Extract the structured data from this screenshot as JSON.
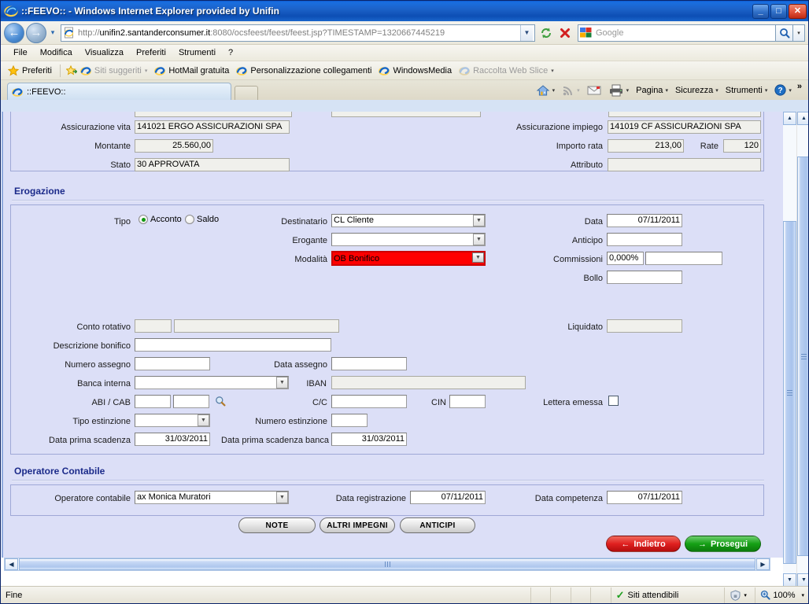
{
  "window": {
    "title": "::FEEVO:: - Windows Internet Explorer provided by Unifin",
    "minimize_label": "_",
    "maximize_label": "□",
    "close_label": "✕"
  },
  "browser": {
    "back_label": "←",
    "forward_label": "→",
    "history_label": "▾",
    "url_prefix": "http://",
    "url_host": "unifin2.santanderconsumer.it",
    "url_rest": ":8080/ocsfeest/feest/feest.jsp?TIMESTAMP=1320667445219",
    "url_full": "http://unifin2.santanderconsumer.it:8080/ocsfeest/feest/feest.jsp?TIMESTAMP=1320667445219",
    "refresh_label": "↻",
    "stop_label": "✕",
    "search_placeholder": "Google",
    "search_value": "",
    "search_go_label": "⌕",
    "search_drop_label": "▾"
  },
  "menu": {
    "items": [
      {
        "label": "File"
      },
      {
        "label": "Modifica"
      },
      {
        "label": "Visualizza"
      },
      {
        "label": "Preferiti"
      },
      {
        "label": "Strumenti"
      },
      {
        "label": "?"
      }
    ]
  },
  "favorites": {
    "button_label": "Preferiti",
    "items": [
      {
        "label": "Siti suggeriti",
        "dim": true,
        "caret": "▾"
      },
      {
        "label": "HotMail gratuita",
        "dim": false,
        "caret": ""
      },
      {
        "label": "Personalizzazione collegamenti",
        "dim": false,
        "caret": ""
      },
      {
        "label": "WindowsMedia",
        "dim": false,
        "caret": ""
      },
      {
        "label": "Raccolta Web Slice",
        "dim": true,
        "caret": "▾"
      }
    ]
  },
  "tabs": {
    "active": {
      "label": "::FEEVO::"
    },
    "new_tab_label": ""
  },
  "command_bar": {
    "home_caret": "▾",
    "feeds_caret": "▾",
    "mail_caret": "",
    "print_caret": "▾",
    "items": [
      {
        "label": "Pagina",
        "caret": "▾"
      },
      {
        "label": "Sicurezza",
        "caret": "▾"
      },
      {
        "label": "Strumenti",
        "caret": "▾"
      },
      {
        "label": "",
        "caret": "▾"
      }
    ],
    "overflow_label": "»"
  },
  "form": {
    "top_rows": [
      {
        "label": "Assicurazione vita",
        "value": "141021 ERGO ASSICURAZIONI SPA"
      },
      {
        "label": "Montante",
        "value": "25.560,00"
      },
      {
        "label": "Stato",
        "value": "30 APPROVATA"
      }
    ],
    "top_rows_right": [
      {
        "label": "Assicurazione impiego",
        "value": "141019 CF ASSICURAZIONI SPA"
      },
      {
        "label": "Importo rata",
        "value": "213,00"
      },
      {
        "label": "Attributo",
        "value": ""
      }
    ],
    "rate": {
      "label": "Rate",
      "value": "120"
    }
  },
  "erogazione": {
    "section_title": "Erogazione",
    "tipo": {
      "label": "Tipo",
      "options": [
        {
          "label": "Acconto",
          "selected": true
        },
        {
          "label": "Saldo",
          "selected": false
        }
      ]
    },
    "destinatario": {
      "label": "Destinatario",
      "value": "CL Cliente"
    },
    "erogante": {
      "label": "Erogante",
      "value": ""
    },
    "modalita": {
      "label": "Modalità",
      "value": "OB Bonifico",
      "highlight_color": "#ff0000"
    },
    "data": {
      "label": "Data",
      "value": "07/11/2011"
    },
    "anticipo": {
      "label": "Anticipo",
      "value": ""
    },
    "commissioni": {
      "label": "Commissioni",
      "value_pct": "0,000%",
      "value_amt": ""
    },
    "bollo": {
      "label": "Bollo",
      "value": ""
    },
    "conto_rotativo": {
      "label": "Conto rotativo",
      "value_a": "",
      "value_b": ""
    },
    "liquidato": {
      "label": "Liquidato",
      "value": ""
    },
    "descrizione_bonifico": {
      "label": "Descrizione bonifico",
      "value": ""
    },
    "numero_assegno": {
      "label": "Numero assegno",
      "value": ""
    },
    "data_assegno": {
      "label": "Data assegno",
      "value": ""
    },
    "banca_interna": {
      "label": "Banca interna",
      "value": ""
    },
    "iban": {
      "label": "IBAN",
      "value": ""
    },
    "abi_cab": {
      "label": "ABI / CAB",
      "value_abi": "",
      "value_cab": "",
      "search_icon": "magnifier-icon"
    },
    "cc": {
      "label": "C/C",
      "value": ""
    },
    "cin": {
      "label": "CIN",
      "value": ""
    },
    "lettera_emessa": {
      "label": "Lettera emessa",
      "checked": false
    },
    "tipo_estinzione": {
      "label": "Tipo estinzione",
      "value": ""
    },
    "numero_estinzione": {
      "label": "Numero estinzione",
      "value": ""
    },
    "data_prima_scadenza": {
      "label": "Data prima scadenza",
      "value": "31/03/2011"
    },
    "data_prima_scadenza_banca": {
      "label": "Data prima scadenza banca",
      "value": "31/03/2011"
    }
  },
  "operatore": {
    "section_title": "Operatore Contabile",
    "operatore_contabile": {
      "label": "Operatore contabile",
      "value": "ax Monica Muratori"
    },
    "data_registrazione": {
      "label": "Data registrazione",
      "value": "07/11/2011"
    },
    "data_competenza": {
      "label": "Data competenza",
      "value": "07/11/2011"
    }
  },
  "actions": {
    "note": "NOTE",
    "altri_impegni": "ALTRI IMPEGNI",
    "anticipi": "ANTICIPI",
    "indietro": "Indietro",
    "prosegui": "Prosegui",
    "indietro_arrow": "←",
    "prosegui_arrow": "→"
  },
  "statusbar": {
    "status_text": "Fine",
    "zone_text": "Siti attendibili",
    "zone_check": "✓",
    "zone_caret": "▾",
    "zoom_text": "100%",
    "zoom_caret": "▾"
  },
  "scrollbars": {
    "up_arrow": "▲",
    "down_arrow": "▼",
    "left_arrow": "◀",
    "right_arrow": "▶"
  },
  "colors": {
    "form_bg": "#dcdff7",
    "section_title": "#1b2a8a",
    "highlight_red": "#ff0000",
    "button_green": "#15a015",
    "button_red": "#e02020"
  }
}
